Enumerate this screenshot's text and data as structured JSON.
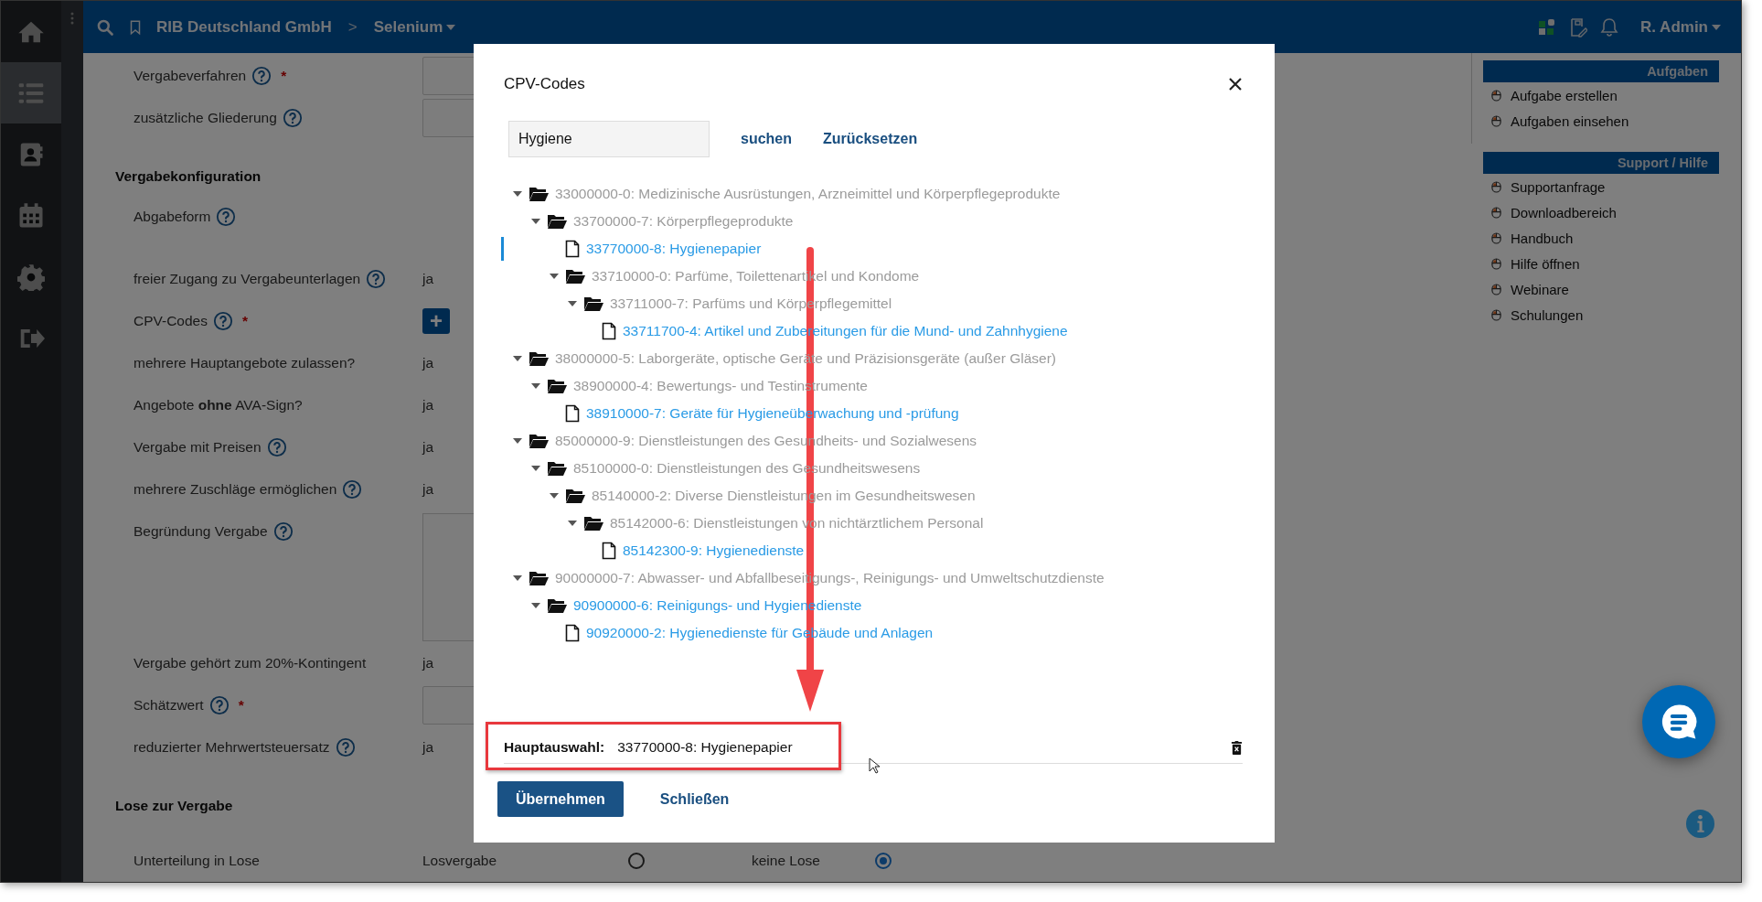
{
  "nav": {
    "items": [
      {
        "selected": false
      },
      {
        "selected": true
      },
      {
        "selected": false
      },
      {
        "selected": false
      },
      {
        "selected": false
      },
      {
        "selected": false
      }
    ]
  },
  "top_bar": {
    "breadcrumb": [
      "RIB Deutschland GmbH",
      "Selenium"
    ],
    "separator": ">",
    "user": "R. Admin"
  },
  "form": {
    "sections": [
      {
        "rows": [
          {
            "label": "Vergabeverfahren",
            "help": true,
            "required_mark": "*",
            "kind": "input"
          },
          {
            "label": "zusätzliche Gliederung",
            "help": true,
            "kind": "input"
          }
        ]
      },
      {
        "title": "Vergabekonfiguration",
        "rows": [
          {
            "label": "Abgabeform",
            "help": true,
            "kind": "none"
          },
          {
            "label": "freier Zugang zu Vergabeunterlagen",
            "help": true,
            "kind": "text",
            "value": "ja"
          },
          {
            "label": "CPV-Codes",
            "help": true,
            "required_mark": "*",
            "kind": "add",
            "value": "+"
          },
          {
            "label": "mehrere Hauptangebote zulassen?",
            "help": false,
            "kind": "text",
            "value": "ja"
          },
          {
            "label": "Angebote **ohne** AVA-Sign?",
            "help": false,
            "kind": "text",
            "value": "ja"
          },
          {
            "label": "Vergabe mit Preisen",
            "help": true,
            "kind": "text",
            "value": "ja"
          },
          {
            "label": "mehrere Zuschläge ermöglichen",
            "help": true,
            "kind": "text",
            "value": "ja"
          },
          {
            "label": "Begründung Vergabe",
            "help": true,
            "kind": "textarea"
          },
          {
            "label": "Vergabe gehört zum 20%-Kontingent",
            "help": false,
            "kind": "text",
            "value": "ja"
          },
          {
            "label": "Schätzwert",
            "help": true,
            "required_mark": "*",
            "kind": "input"
          },
          {
            "label": "reduzierter Mehrwertsteuersatz",
            "help": true,
            "kind": "text",
            "value": "ja"
          }
        ]
      },
      {
        "title": "Lose zur Vergabe",
        "rows": [
          {
            "label": "Unterteilung in Lose",
            "help": false,
            "kind": "radios",
            "options": [
              {
                "label": "Losvergabe",
                "selected": false
              },
              {
                "label": "keine Lose",
                "selected": true
              }
            ]
          }
        ]
      }
    ]
  },
  "side_panel": {
    "groups": [
      {
        "title": "Aufgaben",
        "items": [
          "Aufgabe erstellen",
          "Aufgaben einsehen"
        ]
      },
      {
        "title": "Support / Hilfe",
        "items": [
          "Supportanfrage",
          "Downloadbereich",
          "Handbuch",
          "Hilfe öffnen",
          "Webinare",
          "Schulungen"
        ]
      }
    ]
  },
  "dialog": {
    "title": "CPV-Codes",
    "search": {
      "value": "Hygiene"
    },
    "search_button": "suchen",
    "reset_button": "Zurücksetzen",
    "tree": [
      {
        "kind": "folder",
        "label": "33000000-0: Medizinische Ausrüstungen, Arzneimittel und Körperpflegeprodukte",
        "highlighted": false,
        "selected": false,
        "expanded": true,
        "children": [
          {
            "kind": "folder",
            "label": "33700000-7: Körperpflegeprodukte",
            "highlighted": false,
            "selected": false,
            "expanded": true,
            "children": [
              {
                "kind": "file",
                "label": "33770000-8: Hygienepapier",
                "highlighted": true,
                "selected": true
              },
              {
                "kind": "folder",
                "label": "33710000-0: Parfüme, Toilettenartikel und Kondome",
                "highlighted": false,
                "selected": false,
                "expanded": true,
                "children": [
                  {
                    "kind": "folder",
                    "label": "33711000-7: Parfüms und Körperpflegemittel",
                    "highlighted": false,
                    "selected": false,
                    "expanded": true,
                    "children": [
                      {
                        "kind": "file",
                        "label": "33711700-4: Artikel und Zubereitungen für die Mund- und Zahnhygiene",
                        "highlighted": true,
                        "selected": false
                      }
                    ]
                  }
                ]
              }
            ]
          }
        ]
      },
      {
        "kind": "folder",
        "label": "38000000-5: Laborgeräte, optische Geräte und Präzisionsgeräte (außer Gläser)",
        "highlighted": false,
        "selected": false,
        "expanded": true,
        "children": [
          {
            "kind": "folder",
            "label": "38900000-4: Bewertungs- und Testinstrumente",
            "highlighted": false,
            "selected": false,
            "expanded": true,
            "children": [
              {
                "kind": "file",
                "label": "38910000-7: Geräte für Hygieneüberwachung und -prüfung",
                "highlighted": true,
                "selected": false
              }
            ]
          }
        ]
      },
      {
        "kind": "folder",
        "label": "85000000-9: Dienstleistungen des Gesundheits- und Sozialwesens",
        "highlighted": false,
        "selected": false,
        "expanded": true,
        "children": [
          {
            "kind": "folder",
            "label": "85100000-0: Dienstleistungen des Gesundheitswesens",
            "highlighted": false,
            "selected": false,
            "expanded": true,
            "children": [
              {
                "kind": "folder",
                "label": "85140000-2: Diverse Dienstleistungen im Gesundheitswesen",
                "highlighted": false,
                "selected": false,
                "expanded": true,
                "children": [
                  {
                    "kind": "folder",
                    "label": "85142000-6: Dienstleistungen von nichtärztlichem Personal",
                    "highlighted": false,
                    "selected": false,
                    "expanded": true,
                    "children": [
                      {
                        "kind": "file",
                        "label": "85142300-9: Hygienedienste",
                        "highlighted": true,
                        "selected": false
                      }
                    ]
                  }
                ]
              }
            ]
          }
        ]
      },
      {
        "kind": "folder",
        "label": "90000000-7: Abwasser- und Abfallbeseitigungs-, Reinigungs- und Umweltschutzdienste",
        "highlighted": false,
        "selected": false,
        "expanded": true,
        "children": [
          {
            "kind": "folder",
            "label": "90900000-6: Reinigungs- und Hygienedienste",
            "highlighted": true,
            "selected": false,
            "expanded": true,
            "children": [
              {
                "kind": "file",
                "label": "90920000-2: Hygienedienste für Gebäude und Anlagen",
                "highlighted": true,
                "selected": false
              }
            ]
          }
        ]
      }
    ],
    "main_selection": {
      "label": "Hauptauswahl:",
      "value": "33770000-8: Hygienepapier"
    },
    "apply_button": "Übernehmen",
    "close_button": "Schließen"
  }
}
